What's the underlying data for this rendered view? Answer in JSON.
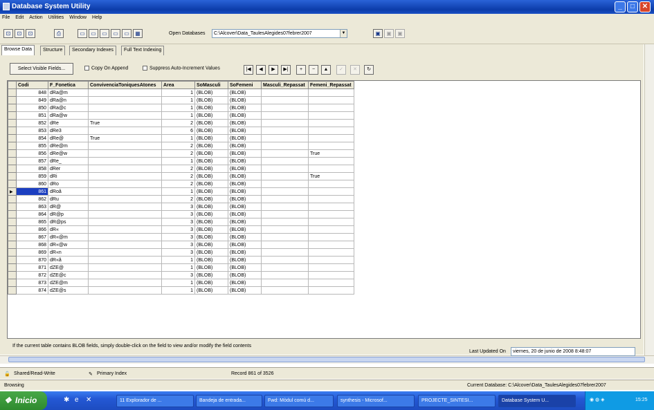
{
  "window": {
    "title": "Database System Utility"
  },
  "menu": [
    "File",
    "Edit",
    "Action",
    "Utilities",
    "Window",
    "Help"
  ],
  "toolbar": {
    "open_db_label": "Open Databases",
    "open_db_value": "C:\\Alcover\\Data_TaulesAlegides07febrer2007"
  },
  "tabs": [
    "Browse Data",
    "Structure",
    "Secondary Indexes",
    "Full Text Indexing"
  ],
  "controls": {
    "select_fields": "Select Visible Fields...",
    "copy_on_append": "Copy On Append",
    "suppress_autoinc": "Suppress Auto-Increment Values"
  },
  "nav_buttons": [
    {
      "name": "first-record-button",
      "glyph": "|◀",
      "enabled": true
    },
    {
      "name": "prior-record-button",
      "glyph": "◀",
      "enabled": true
    },
    {
      "name": "next-record-button",
      "glyph": "▶",
      "enabled": true
    },
    {
      "name": "last-record-button",
      "glyph": "▶|",
      "enabled": true
    },
    {
      "name": "insert-record-button",
      "glyph": "+",
      "enabled": true
    },
    {
      "name": "delete-record-button",
      "glyph": "−",
      "enabled": true
    },
    {
      "name": "edit-record-button",
      "glyph": "▲",
      "enabled": true
    },
    {
      "name": "post-record-button",
      "glyph": "✓",
      "enabled": false
    },
    {
      "name": "cancel-record-button",
      "glyph": "✕",
      "enabled": false
    },
    {
      "name": "refresh-record-button",
      "glyph": "↻",
      "enabled": true
    }
  ],
  "grid": {
    "columns": [
      "Codi",
      "F_Fonetica",
      "ConvivenciaToniquesAtones",
      "Area",
      "SoMasculi",
      "SoFemeni",
      "Masculi_Repassat",
      "Femeni_Repassat"
    ],
    "selected_row": 13,
    "rows": [
      [
        "848",
        "dRa@m",
        "",
        "1",
        "(BLOB)",
        "(BLOB)",
        "",
        ""
      ],
      [
        "849",
        "dRa@n",
        "",
        "1",
        "(BLOB)",
        "(BLOB)",
        "",
        ""
      ],
      [
        "850",
        "dRa@c",
        "",
        "1",
        "(BLOB)",
        "(BLOB)",
        "",
        ""
      ],
      [
        "851",
        "dRa@w",
        "",
        "1",
        "(BLOB)",
        "(BLOB)",
        "",
        ""
      ],
      [
        "852",
        "dRe",
        "True",
        "2",
        "(BLOB)",
        "(BLOB)",
        "",
        ""
      ],
      [
        "853",
        "dRe3",
        "",
        "6",
        "(BLOB)",
        "(BLOB)",
        "",
        ""
      ],
      [
        "854",
        "dRe@",
        "True",
        "1",
        "(BLOB)",
        "(BLOB)",
        "",
        ""
      ],
      [
        "855",
        "dRe@m",
        "",
        "2",
        "(BLOB)",
        "(BLOB)",
        "",
        ""
      ],
      [
        "856",
        "dRe@w",
        "",
        "2",
        "(BLOB)",
        "(BLOB)",
        "",
        "True"
      ],
      [
        "857",
        "dRe_",
        "",
        "1",
        "(BLOB)",
        "(BLOB)",
        "",
        ""
      ],
      [
        "858",
        "dRer",
        "",
        "2",
        "(BLOB)",
        "(BLOB)",
        "",
        ""
      ],
      [
        "859",
        "dRi",
        "",
        "2",
        "(BLOB)",
        "(BLOB)",
        "",
        "True"
      ],
      [
        "860",
        "dRo",
        "",
        "2",
        "(BLOB)",
        "(BLOB)",
        "",
        ""
      ],
      [
        "861",
        "dRoâ",
        "",
        "1",
        "(BLOB)",
        "(BLOB)",
        "",
        ""
      ],
      [
        "862",
        "dRu",
        "",
        "2",
        "(BLOB)",
        "(BLOB)",
        "",
        ""
      ],
      [
        "863",
        "dR@",
        "",
        "3",
        "(BLOB)",
        "(BLOB)",
        "",
        ""
      ],
      [
        "864",
        "dR@p",
        "",
        "3",
        "(BLOB)",
        "(BLOB)",
        "",
        ""
      ],
      [
        "865",
        "dR@ps",
        "",
        "3",
        "(BLOB)",
        "(BLOB)",
        "",
        ""
      ],
      [
        "866",
        "dR«",
        "",
        "3",
        "(BLOB)",
        "(BLOB)",
        "",
        ""
      ],
      [
        "867",
        "dR«@m",
        "",
        "3",
        "(BLOB)",
        "(BLOB)",
        "",
        ""
      ],
      [
        "868",
        "dR«@w",
        "",
        "3",
        "(BLOB)",
        "(BLOB)",
        "",
        ""
      ],
      [
        "869",
        "dR«n",
        "",
        "3",
        "(BLOB)",
        "(BLOB)",
        "",
        ""
      ],
      [
        "870",
        "dR«â",
        "",
        "1",
        "(BLOB)",
        "(BLOB)",
        "",
        ""
      ],
      [
        "871",
        "dZE@",
        "",
        "1",
        "(BLOB)",
        "(BLOB)",
        "",
        ""
      ],
      [
        "872",
        "dZE@c",
        "",
        "3",
        "(BLOB)",
        "(BLOB)",
        "",
        ""
      ],
      [
        "873",
        "dZE@m",
        "",
        "1",
        "(BLOB)",
        "(BLOB)",
        "",
        ""
      ],
      [
        "874",
        "dZE@s",
        "",
        "1",
        "(BLOB)",
        "(BLOB)",
        "",
        ""
      ]
    ]
  },
  "hint": "If the current table contains BLOB fields, simply double-click on the field to view and/or modify the field contents",
  "last_updated": {
    "label": "Last Updated On",
    "value": "viernes, 20 de junio de 2008 8:48:07"
  },
  "status": {
    "mode": "Shared/Read-Write",
    "index": "Primary Index",
    "record": "Record 861 of 3526",
    "state": "Browsing",
    "current_db": "Current Database: C:\\Alcover\\Data_TaulesAlegides07febrer2007"
  },
  "taskbar": {
    "start": "Inicio",
    "tasks": [
      "11 Explorador de ...",
      "Bandeja de entrada...",
      "Fwd: Mòdul comú d...",
      "synthesis - Microsof...",
      "PROJECTE_SINTESI...",
      "Database System U..."
    ],
    "clock": "15:25"
  }
}
